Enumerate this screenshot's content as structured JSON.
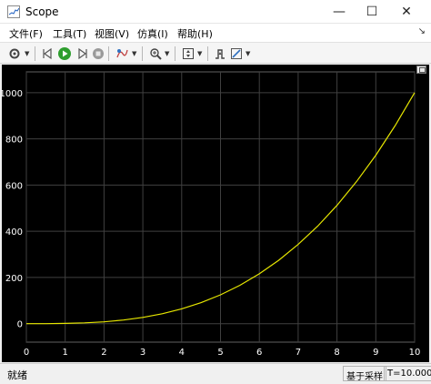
{
  "window": {
    "title": "Scope",
    "minimize_glyph": "—",
    "maximize_glyph": "☐",
    "close_glyph": "✕"
  },
  "menu": {
    "items": [
      "文件(F)",
      "工具(T)",
      "视图(V)",
      "仿真(I)",
      "帮助(H)"
    ],
    "overflow_glyph": "↘"
  },
  "toolbar": {
    "icons": [
      "gear-icon",
      "step-back-icon",
      "run-icon",
      "step-forward-icon",
      "stop-icon",
      "highlight-icon",
      "zoom-icon",
      "scale-axes-icon",
      "triggers-icon",
      "style-icon"
    ],
    "run_color": "#2e9e2e"
  },
  "status": {
    "left_text": "就绪",
    "mode_text": "基于采样",
    "time_text": "T=10.000"
  },
  "colors": {
    "plot_background": "#000000",
    "grid": "#404040",
    "axis_text": "#ffffff",
    "line": "#e6e600"
  },
  "chart_data": {
    "type": "line",
    "title": "",
    "xlabel": "",
    "ylabel": "",
    "xlim": [
      0,
      10
    ],
    "ylim": [
      -80,
      1090
    ],
    "grid": true,
    "xticks": [
      "0",
      "1",
      "2",
      "3",
      "4",
      "5",
      "6",
      "7",
      "8",
      "9",
      "10"
    ],
    "yticks": [
      "0",
      "200",
      "400",
      "600",
      "800",
      "1000"
    ],
    "series": [
      {
        "color": "#e6e600",
        "x": [
          0,
          0.5,
          1,
          1.5,
          2,
          2.5,
          3,
          3.5,
          4,
          4.5,
          5,
          5.5,
          6,
          6.5,
          7,
          7.5,
          8,
          8.5,
          9,
          9.5,
          10
        ],
        "y": [
          0,
          0.1,
          1,
          3.4,
          8,
          15.6,
          27,
          42.9,
          64,
          91.1,
          125,
          166.4,
          216,
          274.6,
          343,
          421.9,
          512,
          614.1,
          729,
          857.4,
          1000
        ]
      }
    ]
  }
}
